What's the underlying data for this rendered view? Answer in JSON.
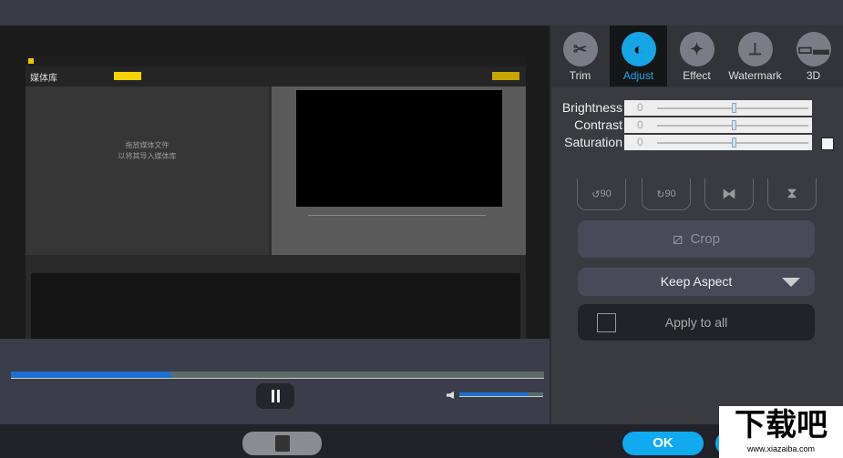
{
  "preview": {
    "embedded_app": {
      "library_title": "媒体库",
      "drop_hint_line1": "拖放媒体文件",
      "drop_hint_line2": "以将其导入媒体库"
    }
  },
  "playback": {
    "progress_percent": 30,
    "volume_percent": 83,
    "pause_icon": "pause-icon",
    "volume_icon": "speaker-icon"
  },
  "tabs": [
    {
      "label": "Trim",
      "icon": "scissors-icon"
    },
    {
      "label": "Adjust",
      "icon": "brightness-icon",
      "active": true
    },
    {
      "label": "Effect",
      "icon": "magic-wand-icon"
    },
    {
      "label": "Watermark",
      "icon": "watermark-icon"
    },
    {
      "label": "3D",
      "icon": "3d-glasses-icon"
    }
  ],
  "adjust": {
    "brightness": {
      "label": "Brightness",
      "value": "0"
    },
    "contrast": {
      "label": "Contrast",
      "value": "0"
    },
    "saturation": {
      "label": "Saturation",
      "value": "0"
    }
  },
  "rotate": {
    "rotate_left_label": "90",
    "rotate_right_label": "90"
  },
  "crop_label": "Crop",
  "aspect_select": "Keep Aspect",
  "apply_all_label": "Apply to all",
  "ok_label": "OK",
  "colors": {
    "accent": "#15a6e6",
    "progress": "#1a6fd0"
  },
  "watermark_logo": "下载吧 www.xiazaiba.com"
}
